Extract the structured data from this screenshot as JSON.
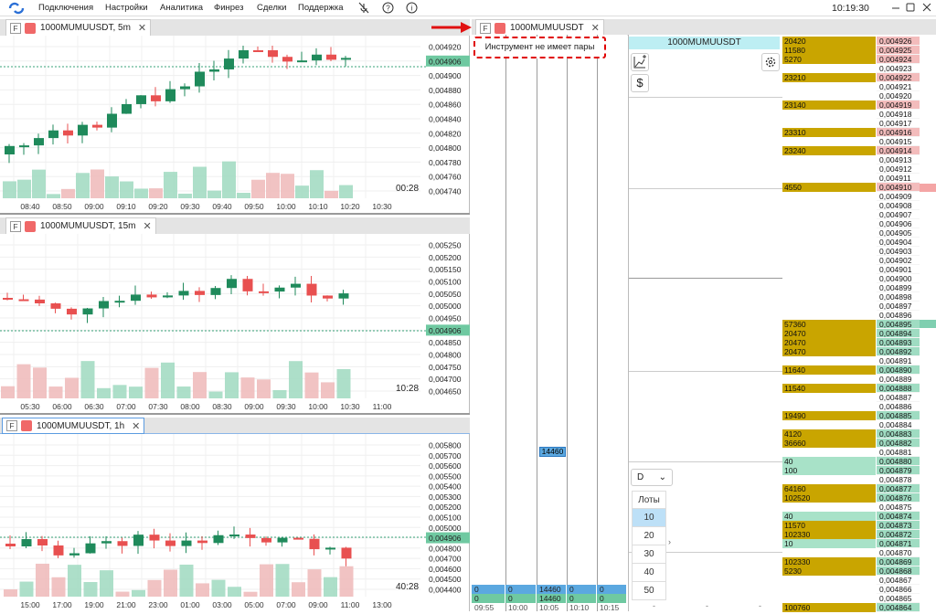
{
  "menu": {
    "items": [
      "Подключения",
      "Настройки",
      "Аналитика",
      "Финрез",
      "Сделки",
      "Поддержка"
    ],
    "clock": "10:19:30"
  },
  "charts": [
    {
      "tab": "1000MUMUUSDT, 5m",
      "prices": [
        "0,004920",
        "0,004906",
        "0,004900",
        "0,004880",
        "0,004860",
        "0,004840",
        "0,004820",
        "0,004800",
        "0,004780",
        "0,004760",
        "0,004740"
      ],
      "times": [
        "08:40",
        "08:50",
        "09:00",
        "09:10",
        "09:20",
        "09:30",
        "09:40",
        "09:50",
        "10:00",
        "10:10",
        "10:20",
        "10:30"
      ],
      "countdown": "00:28",
      "last": "0,004906"
    },
    {
      "tab": "1000MUMUUSDT, 15m",
      "prices": [
        "0,005250",
        "0,005200",
        "0,005150",
        "0,005100",
        "0,005050",
        "0,005000",
        "0,004950",
        "0,004906",
        "0,004850",
        "0,004800",
        "0,004750",
        "0,004700",
        "0,004650"
      ],
      "times": [
        "05:30",
        "06:00",
        "06:30",
        "07:00",
        "07:30",
        "08:00",
        "08:30",
        "09:00",
        "09:30",
        "10:00",
        "10:30",
        "11:00"
      ],
      "countdown": "10:28",
      "last": "0,004906"
    },
    {
      "tab": "1000MUMUUSDT, 1h",
      "prices": [
        "0,005800",
        "0,005700",
        "0,005600",
        "0,005500",
        "0,005400",
        "0,005300",
        "0,005200",
        "0,005100",
        "0,005000",
        "0,004906",
        "0,004800",
        "0,004700",
        "0,004600",
        "0,004500",
        "0,004400"
      ],
      "times": [
        "15:00",
        "17:00",
        "19:00",
        "21:00",
        "23:00",
        "01:00",
        "03:00",
        "05:00",
        "07:00",
        "09:00",
        "11:00",
        "13:00"
      ],
      "countdown": "40:28",
      "last": "0,004906"
    }
  ],
  "dom": {
    "tab": "1000MUMUUSDT",
    "notice": "Инструмент не имеет пары",
    "cluster_value": "14460",
    "rows": [
      [
        "0",
        "0",
        "14460",
        "0",
        "0"
      ],
      [
        "0",
        "0",
        "14460",
        "0",
        "0"
      ]
    ],
    "times": [
      "09:55",
      "10:00",
      "10:05",
      "10:10",
      "10:15"
    ]
  },
  "orderbook": {
    "symbol": "1000MUMUUSDT",
    "dropdown": "D",
    "lots_label": "Лоты",
    "lots": [
      "10",
      "20",
      "30",
      "40",
      "50"
    ],
    "bottom_dashes": [
      "-",
      "-",
      "-"
    ],
    "rows": [
      [
        "20420",
        "0,004926",
        "a"
      ],
      [
        "11580",
        "0,004925",
        "a"
      ],
      [
        "5270",
        "0,004924",
        "a"
      ],
      [
        "",
        "0,004923",
        ""
      ],
      [
        "23210",
        "0,004922",
        "a"
      ],
      [
        "",
        "0,004921",
        ""
      ],
      [
        "",
        "0,004920",
        ""
      ],
      [
        "23140",
        "0,004919",
        "a"
      ],
      [
        "",
        "0,004918",
        ""
      ],
      [
        "",
        "0,004917",
        ""
      ],
      [
        "23310",
        "0,004916",
        "a"
      ],
      [
        "",
        "0,004915",
        ""
      ],
      [
        "23240",
        "0,004914",
        "a"
      ],
      [
        "",
        "0,004913",
        ""
      ],
      [
        "",
        "0,004912",
        ""
      ],
      [
        "",
        "0,004911",
        ""
      ],
      [
        "4550",
        "0,004910",
        "a"
      ],
      [
        "",
        "0,004909",
        ""
      ],
      [
        "",
        "0,004908",
        ""
      ],
      [
        "",
        "0,004907",
        ""
      ],
      [
        "",
        "0,004906",
        ""
      ],
      [
        "",
        "0,004905",
        ""
      ],
      [
        "",
        "0,004904",
        ""
      ],
      [
        "",
        "0,004903",
        ""
      ],
      [
        "",
        "0,004902",
        ""
      ],
      [
        "",
        "0,004901",
        ""
      ],
      [
        "",
        "0,004900",
        ""
      ],
      [
        "",
        "0,004899",
        ""
      ],
      [
        "",
        "0,004898",
        ""
      ],
      [
        "",
        "0,004897",
        ""
      ],
      [
        "",
        "0,004896",
        ""
      ],
      [
        "57360",
        "0,004895",
        "b"
      ],
      [
        "20470",
        "0,004894",
        "b"
      ],
      [
        "20470",
        "0,004893",
        "b"
      ],
      [
        "20470",
        "0,004892",
        "b"
      ],
      [
        "",
        "0,004891",
        ""
      ],
      [
        "11640",
        "0,004890",
        "b"
      ],
      [
        "",
        "0,004889",
        ""
      ],
      [
        "11540",
        "0,004888",
        "b"
      ],
      [
        "",
        "0,004887",
        ""
      ],
      [
        "",
        "0,004886",
        ""
      ],
      [
        "19490",
        "0,004885",
        "b"
      ],
      [
        "",
        "0,004884",
        ""
      ],
      [
        "4120",
        "0,004883",
        "b"
      ],
      [
        "36660",
        "0,004882",
        "b"
      ],
      [
        "",
        "0,004881",
        ""
      ],
      [
        "40",
        "0,004880",
        "g"
      ],
      [
        "100",
        "0,004879",
        "g"
      ],
      [
        "",
        "0,004878",
        ""
      ],
      [
        "64160",
        "0,004877",
        "b"
      ],
      [
        "102520",
        "0,004876",
        "b"
      ],
      [
        "",
        "0,004875",
        ""
      ],
      [
        "40",
        "0,004874",
        "g"
      ],
      [
        "11570",
        "0,004873",
        "b"
      ],
      [
        "102330",
        "0,004872",
        "b"
      ],
      [
        "10",
        "0,004871",
        "g"
      ],
      [
        "",
        "0,004870",
        ""
      ],
      [
        "102330",
        "0,004869",
        "b"
      ],
      [
        "5230",
        "0,004868",
        "b"
      ],
      [
        "",
        "0,004867",
        ""
      ],
      [
        "",
        "0,004866",
        ""
      ],
      [
        "",
        "0,004865",
        ""
      ],
      [
        "100760",
        "0,004864",
        "b"
      ]
    ]
  }
}
